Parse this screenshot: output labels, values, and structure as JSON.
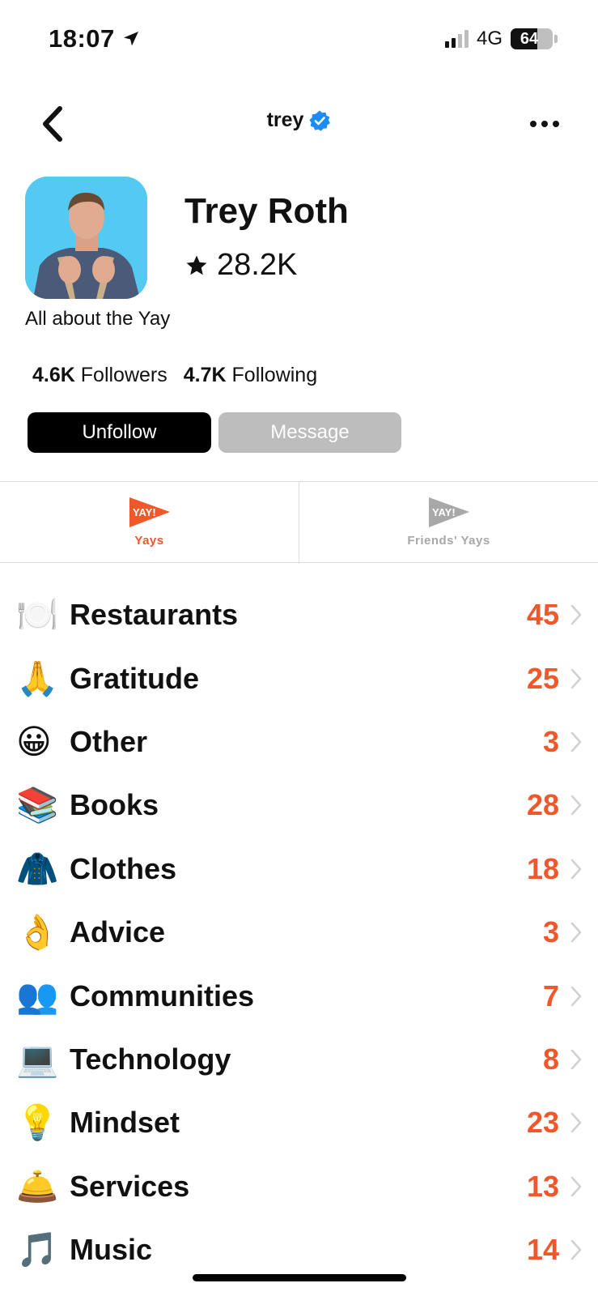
{
  "status_bar": {
    "time": "18:07",
    "network": "4G",
    "battery": "64",
    "battery_level": 0.64
  },
  "header": {
    "username": "trey",
    "verified_icon": "verified-badge-icon",
    "back_icon": "chevron-left-icon",
    "more_icon": "more-horizontal-icon"
  },
  "profile": {
    "name": "Trey Roth",
    "score": "28.2K",
    "score_icon": "star-icon",
    "bio": "All about the Yay",
    "followers_count": "4.6K",
    "followers_label": "Followers",
    "following_count": "4.7K",
    "following_label": "Following",
    "unfollow_label": "Unfollow",
    "message_label": "Message"
  },
  "tabs": [
    {
      "label": "Yays",
      "icon": "yay-flag-icon",
      "active": true
    },
    {
      "label": "Friends' Yays",
      "icon": "yay-flag-icon",
      "active": false
    }
  ],
  "categories": [
    {
      "emoji": "🍽️",
      "label": "Restaurants",
      "count": "45"
    },
    {
      "emoji": "🙏",
      "label": "Gratitude",
      "count": "25"
    },
    {
      "emoji": "😀",
      "label": "Other",
      "count": "3"
    },
    {
      "emoji": "📚",
      "label": "Books",
      "count": "28"
    },
    {
      "emoji": "🧥",
      "label": "Clothes",
      "count": "18"
    },
    {
      "emoji": "👌",
      "label": "Advice",
      "count": "3"
    },
    {
      "emoji": "👥",
      "label": "Communities",
      "count": "7"
    },
    {
      "emoji": "💻",
      "label": "Technology",
      "count": "8"
    },
    {
      "emoji": "💡",
      "label": "Mindset",
      "count": "23"
    },
    {
      "emoji": "🛎️",
      "label": "Services",
      "count": "13"
    },
    {
      "emoji": "🎵",
      "label": "Music",
      "count": "14"
    }
  ],
  "colors": {
    "accent": "#f0572a",
    "verified": "#1d8cf8",
    "avatar_bg": "#54c9f1",
    "button_primary": "#000000",
    "button_disabled": "#bdbdbd"
  }
}
